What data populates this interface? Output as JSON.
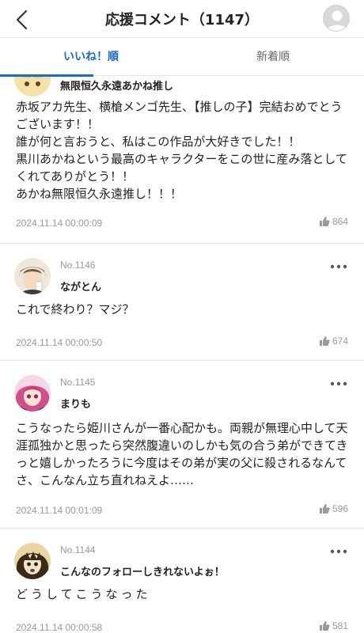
{
  "header": {
    "title": "応援コメント（1147）"
  },
  "tabs": [
    {
      "label": "いいね！順",
      "active": true
    },
    {
      "label": "新着順",
      "active": false
    }
  ],
  "colors": {
    "accent": "#1a6cd1",
    "meta_text": "#999999"
  },
  "comments": [
    {
      "name": "無限恒久永遠あかね推し",
      "body": "赤坂アカ先生、横槍メンゴ先生、【推しの子】完結おめでとうございます！！\n誰が何と言おうと、私はこの作品が大好きでした！！\n黒川あかねという最高のキャラクターをこの世に産み落としてくれてありがとう！！\nあかね無限恒久永遠推し！！！",
      "date": "2024.11.14 00:00:09",
      "likes": "864"
    },
    {
      "number": "No.1146",
      "name": "ながとん",
      "body": "これで終わり？マジ？",
      "date": "2024.11.14 00:00:50",
      "likes": "674"
    },
    {
      "number": "No.1145",
      "name": "まりも",
      "body": "こうなったら姫川さんが一番心配かも。両親が無理心中して天涯孤独かと思ったら突然腹違いのしかも気の合う弟ができてきっと嬉しかったろうに今度はその弟が実の父に殺されるなんてさ、こんなん立ち直れねえよ……",
      "date": "2024.11.14 00:01:09",
      "likes": "596"
    },
    {
      "number": "No.1144",
      "name": "こんなのフォローしきれないよぉ！",
      "body": "どうしてこうなった",
      "date": "2024.11.14 00:00:58",
      "likes": "581"
    }
  ]
}
